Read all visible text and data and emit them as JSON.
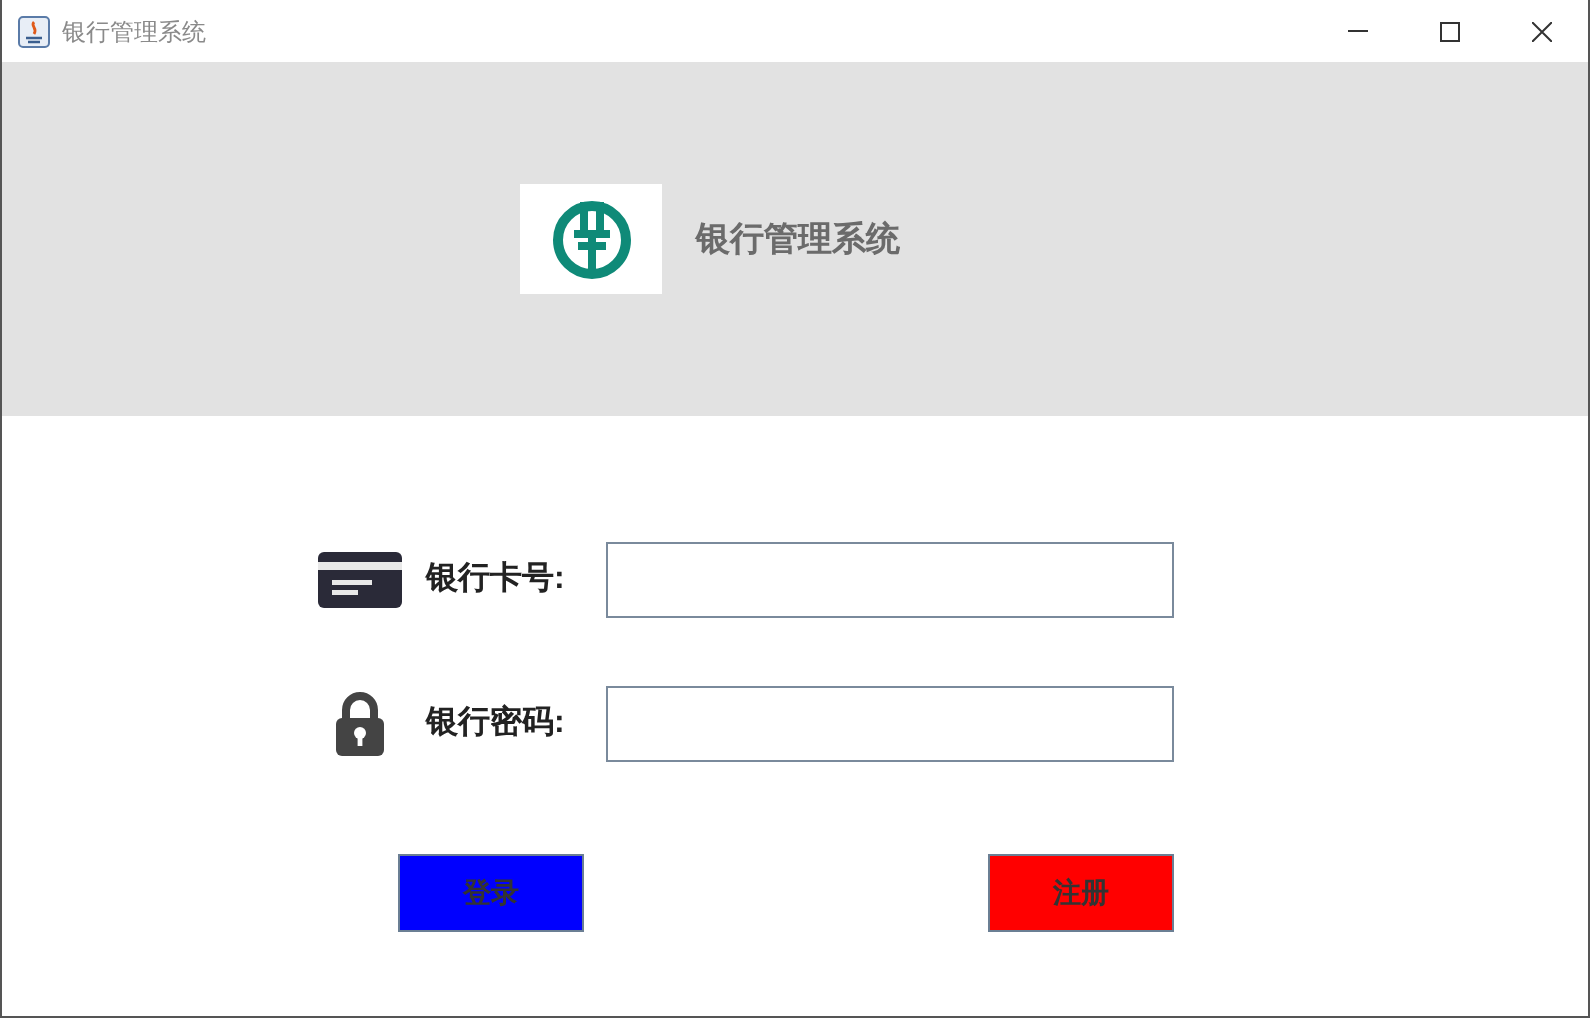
{
  "window": {
    "title": "银行管理系统"
  },
  "header": {
    "title": "银行管理系统"
  },
  "fields": [
    {
      "kind": "card",
      "label": "银行卡号:"
    },
    {
      "kind": "lock",
      "label": "银行密码:"
    }
  ],
  "buttons": [
    {
      "label": "登录",
      "color": "#0000ff"
    },
    {
      "label": "注册",
      "color": "#ff0000"
    }
  ]
}
